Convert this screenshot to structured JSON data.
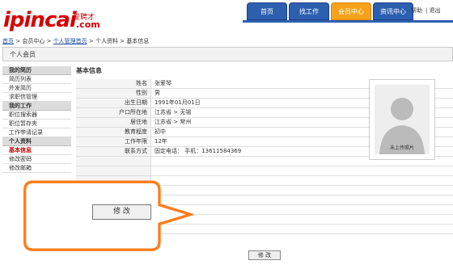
{
  "header": {
    "logo_en": "ipincai",
    "logo_cn": "爱聘才",
    "logo_com": ".com",
    "nav": [
      "首页",
      "找工作",
      "会员中心",
      "资讯中心"
    ],
    "active_nav": 2,
    "help": "帮助",
    "logout": "退出"
  },
  "breadcrumb": {
    "home": "首页",
    "sep1": " > 会员中心 > ",
    "manage": "个人管理首页",
    "sep2": " > 个人资料 > 基本信息"
  },
  "section_title": "个人会员",
  "sidebar": {
    "groups": [
      {
        "title": "我的简历",
        "items": [
          "简历列表",
          "外发简历",
          "求职信管理"
        ]
      },
      {
        "title": "我的工作",
        "items": [
          "职位搜索器",
          "职位暂存夹",
          "工作申请记录"
        ]
      },
      {
        "title": "个人资料",
        "items": [
          "基本信息",
          "修改密码",
          "修改邮箱"
        ]
      }
    ],
    "active_item": "基本信息"
  },
  "main": {
    "title": "基本信息",
    "rows": [
      {
        "label": "姓名",
        "value": "张爱琴"
      },
      {
        "label": "性别",
        "value": "男"
      },
      {
        "label": "出生日期",
        "value": "1991年01月01日"
      },
      {
        "label": "户口所在地",
        "value": "江苏省 > 无锡"
      },
      {
        "label": "居住地",
        "value": "江苏省 > 常州"
      },
      {
        "label": "教育程度",
        "value": "初中"
      },
      {
        "label": "工作年限",
        "value": "12年"
      },
      {
        "label": "联系方式",
        "value": "固定电话：   手机：13611584369"
      }
    ],
    "photo_caption": "未上传照片",
    "bottom_button": "修 改"
  },
  "callout": {
    "button_label": "修 改",
    "border_color": "#ff7d1a"
  }
}
